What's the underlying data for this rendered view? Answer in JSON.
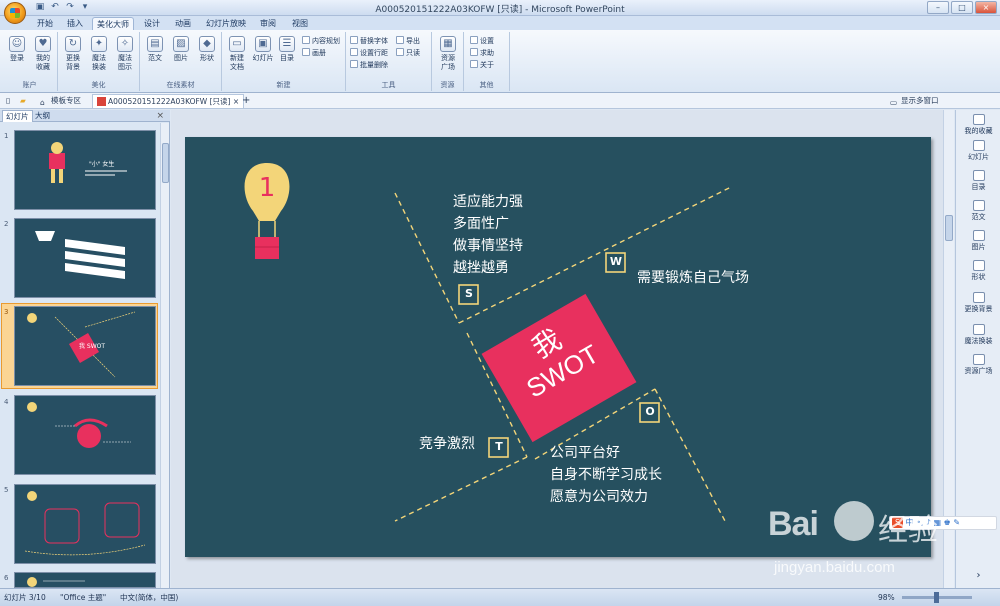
{
  "window": {
    "title": "A000520151222A03KOFW [只读] - Microsoft PowerPoint"
  },
  "ribbon": {
    "tabs": [
      "开始",
      "插入",
      "美化大师",
      "设计",
      "动画",
      "幻灯片放映",
      "审阅",
      "视图"
    ],
    "active_tab": "美化大师",
    "groups": [
      {
        "label": "账户",
        "big": [
          "登录",
          "我的\n收藏"
        ]
      },
      {
        "label": "美化",
        "big": [
          "更换\n背景",
          "魔法\n换装",
          "魔法\n图示"
        ]
      },
      {
        "label": "在线素材",
        "big": [
          "范文",
          "图片",
          "形状"
        ]
      },
      {
        "label": "新建",
        "big": [
          "新建\n文档",
          "幻灯片",
          "目录"
        ],
        "small": [
          "内容规划",
          "画册"
        ]
      },
      {
        "label": "工具",
        "small": [
          "替换字体",
          "设置行距",
          "批量删除",
          "导出",
          "只读"
        ]
      },
      {
        "label": "资源",
        "big": [
          "资源\n广场"
        ]
      },
      {
        "label": "其他",
        "small": [
          "设置",
          "求助",
          "关于"
        ]
      }
    ]
  },
  "doc_tabs": {
    "templates": "模板专区",
    "active": "A000520151222A03KOFW [只读]",
    "add": "+",
    "multi_window": "显示多窗口"
  },
  "left_panel": {
    "tabs": [
      "幻灯片",
      "大纲"
    ],
    "close": "×",
    "slides": [
      {
        "num": "1",
        "text": "\"小\" 女生"
      },
      {
        "num": "2",
        "text": ""
      },
      {
        "num": "3",
        "text": "我 SWOT"
      },
      {
        "num": "4",
        "text": ""
      },
      {
        "num": "5",
        "text": ""
      },
      {
        "num": "6",
        "text": ""
      }
    ]
  },
  "slide": {
    "number_badge": "1",
    "center_top": "我",
    "center_bottom": "SWOT",
    "s": {
      "letter": "S",
      "lines": [
        "适应能力强",
        "多面性广",
        "做事情坚持",
        "越挫越勇"
      ]
    },
    "w": {
      "letter": "W",
      "lines": [
        "需要锻炼自己气场"
      ]
    },
    "o": {
      "letter": "O",
      "lines": [
        "公司平台好",
        "自身不断学习成长",
        "愿意为公司效力"
      ]
    },
    "t": {
      "letter": "T",
      "lines": [
        "竞争激烈"
      ]
    }
  },
  "right_panel": {
    "items": [
      "我的收藏",
      "幻灯片",
      "目录",
      "范文",
      "图片",
      "形状",
      "更换背景",
      "魔法换装",
      "资源广场"
    ]
  },
  "status": {
    "slide_info": "幻灯片 3/10",
    "theme": "\"Office 主题\"",
    "language": "中文(简体，中国)",
    "zoom": "98%"
  },
  "overlay": {
    "ime": "中",
    "watermark_brand": "Bai",
    "watermark_cn": "经验",
    "watermark_url": "jingyan.baidu.com"
  },
  "colors": {
    "slide_bg": "#26505f",
    "accent_pink": "#e8305e",
    "accent_yellow": "#f3d579",
    "selection": "#f3a13a"
  }
}
